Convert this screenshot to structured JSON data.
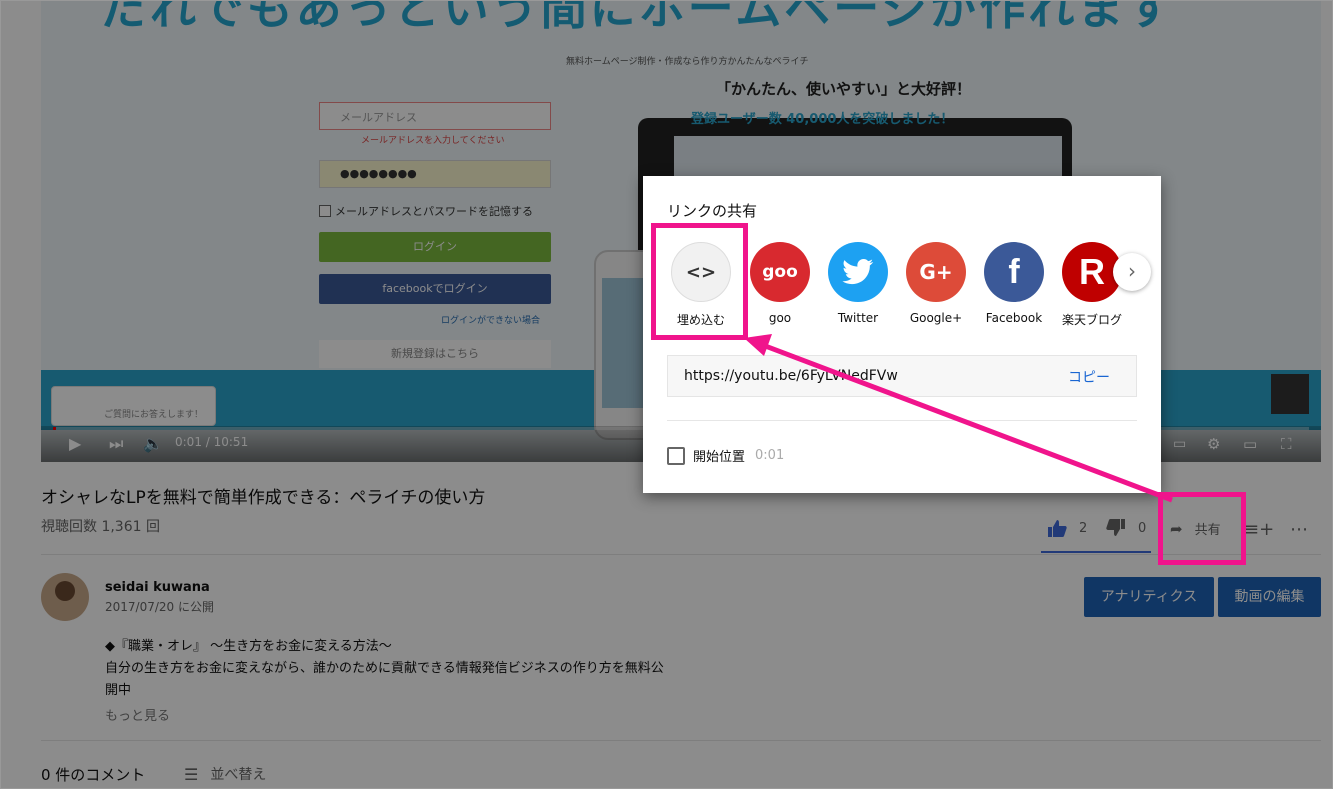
{
  "video": {
    "headline": "だれでもあっという間にホームページが作れます",
    "subtitle": "無料ホームページ制作・作成なら作り方かんたんなペライチ",
    "email_placeholder": "メールアドレス",
    "email_error": "メールアドレスを入力してください",
    "password_value": "●●●●●●●●",
    "remember_label": "メールアドレスとパスワードを記憶する",
    "login_label": "ログイン",
    "fb_login_label": "facebookでログイン",
    "forgot_label": "ログインができない場合",
    "register_label": "新規登録はこちら",
    "promo_text": "「かんたん、使いやすい」と大好評！",
    "users_text": "登録ユーザー数 40,000人を突破しました！",
    "chat_text": "ご質問にお答えします！",
    "time_display": "0:01 / 10:51",
    "progress_fraction": 0.002
  },
  "video_title": "オシャレなLPを無料で簡単作成できる：ペライチの使い方",
  "view_count": "視聴回数 1,361 回",
  "actions": {
    "like_count": "2",
    "dislike_count": "0",
    "share_label": "共有",
    "add_icon": "playlist-add-icon",
    "more_icon": "more-icon"
  },
  "channel": {
    "name": "seidai kuwana",
    "published": "2017/07/20 に公開",
    "analytics_label": "アナリティクス",
    "edit_label": "動画の編集"
  },
  "description": {
    "line1": "◆『職業・オレ』 〜生き方をお金に変える方法〜",
    "line2": "自分の生き方をお金に変えながら、誰かのために貢献できる情報発信ビジネスの作り方を無料公",
    "line3": "開中",
    "more_label": "もっと見る"
  },
  "comments": {
    "count_label": "0 件のコメント",
    "sort_label": "並べ替え"
  },
  "share_dialog": {
    "title": "リンクの共有",
    "items": [
      {
        "label": "埋め込む",
        "glyph": "<>",
        "color": "#f1f1f1"
      },
      {
        "label": "goo",
        "glyph": "goo",
        "color": "#d8292f"
      },
      {
        "label": "Twitter",
        "glyph": "",
        "color": "#1da1f2"
      },
      {
        "label": "Google+",
        "glyph": "G+",
        "color": "#dd4b39"
      },
      {
        "label": "Facebook",
        "glyph": "f",
        "color": "#3b5998"
      },
      {
        "label": "楽天ブログ",
        "glyph": "R",
        "color": "#bf0000"
      }
    ],
    "url": "https://youtu.be/6FyLVNedFVw",
    "copy_label": "コピー",
    "start_label": "開始位置",
    "start_time": "0:01"
  },
  "colors": {
    "accent_blue": "#1e63b6",
    "highlight_pink": "#f0148c",
    "like_blue": "#3e6bdb"
  }
}
